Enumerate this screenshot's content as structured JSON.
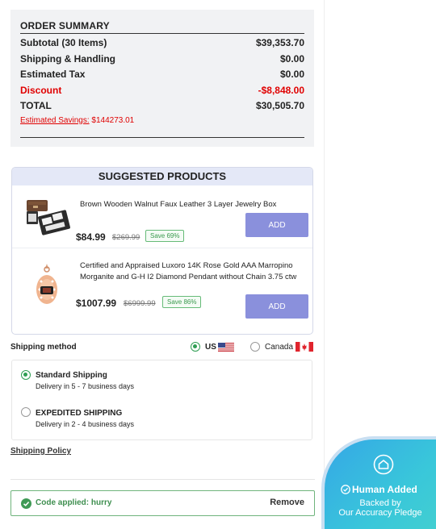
{
  "order_summary": {
    "title": "ORDER SUMMARY",
    "rows": [
      {
        "label": "Subtotal (30 Items)",
        "value": "$39,353.70"
      },
      {
        "label": "Shipping & Handling",
        "value": "$0.00"
      },
      {
        "label": "Estimated Tax",
        "value": "$0.00"
      },
      {
        "label": "Discount",
        "value": "-$8,848.00"
      },
      {
        "label": "TOTAL",
        "value": "$30,505.70"
      }
    ],
    "savings_label": "Estimated Savings:",
    "savings_value": "$144273.01"
  },
  "suggested": {
    "title": "SUGGESTED PRODUCTS",
    "products": [
      {
        "name": "Brown Wooden Walnut Faux Leather 3 Layer Jewelry Box",
        "price": "$84.99",
        "original_price": "$269.99",
        "save": "Save 69%",
        "add_label": "ADD",
        "image_icon": "jewelry-box-icon"
      },
      {
        "name": "Certified and Appraised Luxoro 14K Rose Gold AAA Marropino Morganite and G-H I2 Diamond Pendant without Chain 3.75 ctw",
        "price": "$1007.99",
        "original_price": "$6999.99",
        "save": "Save 86%",
        "add_label": "ADD",
        "image_icon": "pendant-icon"
      }
    ]
  },
  "shipping": {
    "method_label": "Shipping method",
    "countries": [
      {
        "label": "US",
        "selected": true,
        "flag_icon": "us-flag-icon"
      },
      {
        "label": "Canada",
        "selected": false,
        "flag_icon": "canada-flag-icon"
      }
    ],
    "options": [
      {
        "title": "Standard Shipping",
        "subtitle": "Delivery in 5 - 7 business days",
        "selected": true
      },
      {
        "title": "EXPEDITED SHIPPING",
        "subtitle": "Delivery in 2 - 4 business days",
        "selected": false
      }
    ],
    "policy_link": "Shipping Policy"
  },
  "coupon": {
    "text": "Code applied: hurry",
    "remove_label": "Remove",
    "icon": "check-circle-icon"
  },
  "trust_badge": {
    "title": "Human Added",
    "line1": "Backed by",
    "line2": "Our Accuracy Pledge",
    "icon": "home-shield-icon"
  },
  "colors": {
    "discount_red": "#e00000",
    "add_button": "#8a90dc",
    "success_green": "#3f8f50",
    "badge_blue": "#35a7e6"
  }
}
